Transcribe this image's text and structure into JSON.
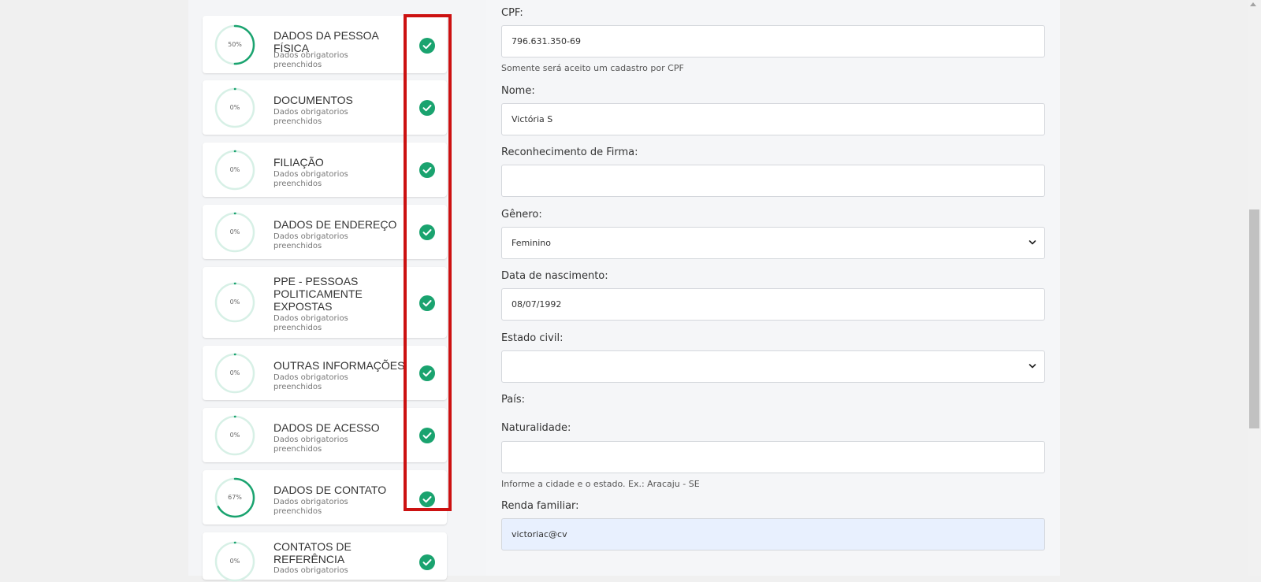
{
  "steps": [
    {
      "title": "DADOS DA PESSOA FÍSICA",
      "subtitle": "Dados obrigatorios preenchidos",
      "percent_label": "50%",
      "progress": 0.5,
      "icon": "check-circle-icon"
    },
    {
      "title": "DOCUMENTOS",
      "subtitle": "Dados obrigatorios preenchidos",
      "percent_label": "0%",
      "progress": 0,
      "icon": "check-circle-icon"
    },
    {
      "title": "FILIAÇÃO",
      "subtitle": "Dados obrigatorios preenchidos",
      "percent_label": "0%",
      "progress": 0,
      "icon": "check-circle-icon"
    },
    {
      "title": "DADOS DE ENDEREÇO",
      "subtitle": "Dados obrigatorios preenchidos",
      "percent_label": "0%",
      "progress": 0,
      "icon": "check-circle-icon"
    },
    {
      "title": "PPE - PESSOAS POLITICAMENTE EXPOSTAS",
      "subtitle": "Dados obrigatorios preenchidos",
      "percent_label": "0%",
      "progress": 0,
      "icon": "check-circle-icon"
    },
    {
      "title": "OUTRAS INFORMAÇÕES",
      "subtitle": "Dados obrigatorios preenchidos",
      "percent_label": "0%",
      "progress": 0,
      "icon": "check-circle-icon"
    },
    {
      "title": "DADOS DE ACESSO",
      "subtitle": "Dados obrigatorios preenchidos",
      "percent_label": "0%",
      "progress": 0,
      "icon": "check-circle-icon"
    },
    {
      "title": "DADOS DE CONTATO",
      "subtitle": "Dados obrigatorios preenchidos",
      "percent_label": "67%",
      "progress": 0.67,
      "icon": "check-circle-icon"
    },
    {
      "title": "CONTATOS DE REFERÊNCIA",
      "subtitle": "Dados obrigatorios",
      "percent_label": "0%",
      "progress": 0,
      "icon": "check-circle-icon"
    }
  ],
  "form": {
    "cpf": {
      "label": "CPF:",
      "value": "796.631.350-69",
      "help": "Somente será aceito um cadastro por CPF"
    },
    "nome": {
      "label": "Nome:",
      "value": "Victória S"
    },
    "reconhecimento": {
      "label": "Reconhecimento de Firma:",
      "value": ""
    },
    "genero": {
      "label": "Gênero:",
      "value": "Feminino"
    },
    "nascimento": {
      "label": "Data de nascimento:",
      "value": "08/07/1992"
    },
    "estado_civil": {
      "label": "Estado civil:",
      "value": ""
    },
    "pais": {
      "label": "País:"
    },
    "naturalidade": {
      "label": "Naturalidade:",
      "value": "",
      "help": "Informe a cidade e o estado. Ex.: Aracaju - SE"
    },
    "renda": {
      "label": "Renda familiar:",
      "value": "victoriac@cv"
    }
  },
  "colors": {
    "accent_green": "#1aa36f",
    "ring_track": "#d7f0e6",
    "highlight_frame": "#cc1111",
    "autofill_bg": "#e8f0fe"
  }
}
